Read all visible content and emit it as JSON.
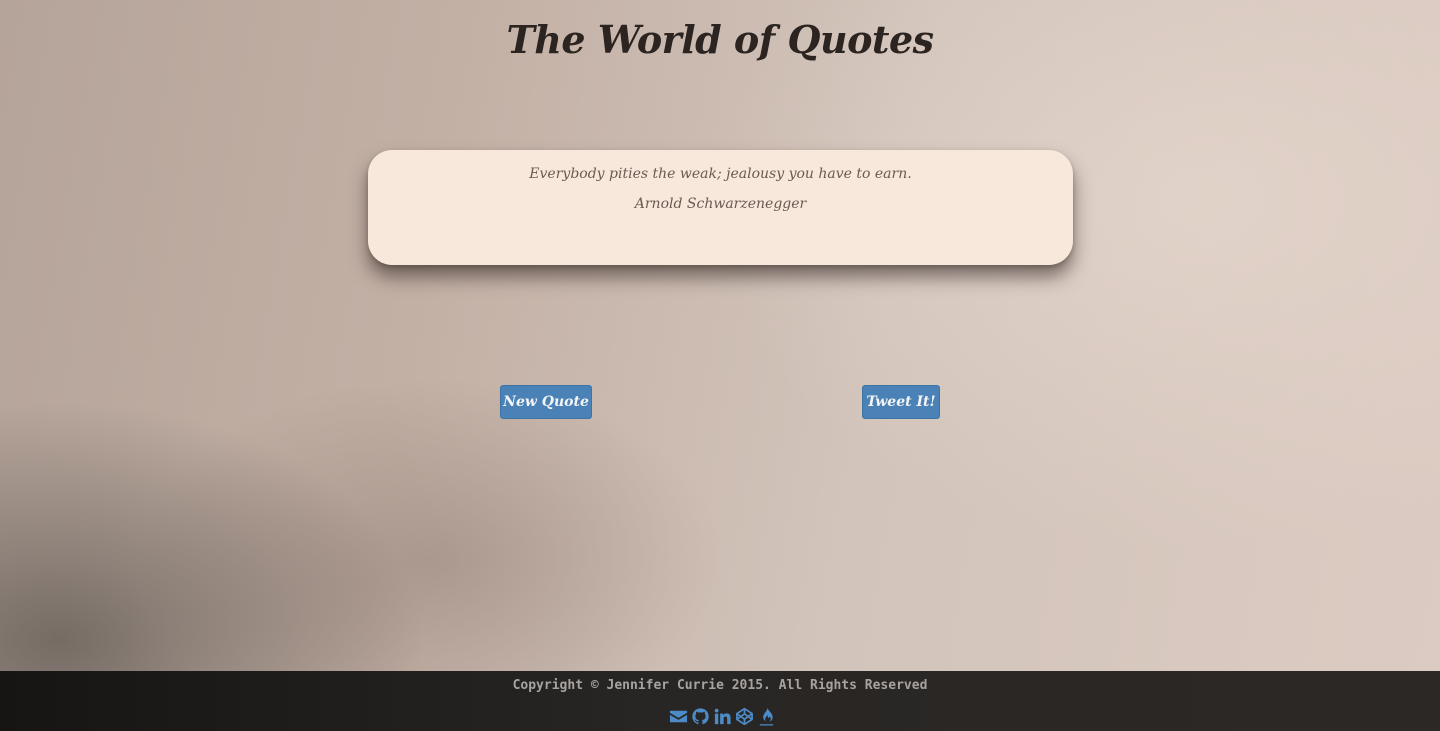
{
  "header": {
    "title": "The World of Quotes"
  },
  "quote": {
    "text": "Everybody pities the weak; jealousy you have to earn.",
    "author": "Arnold Schwarzenegger"
  },
  "actions": {
    "new_quote_label": "New Quote",
    "tweet_label": "Tweet It!"
  },
  "footer": {
    "copyright": "Copyright © Jennifer Currie 2015. All Rights Reserved",
    "social_icons": [
      "envelope-icon",
      "github-icon",
      "linkedin-icon",
      "codepen-icon",
      "freecodecamp-icon"
    ]
  },
  "colors": {
    "button": "#4a82b8",
    "icon": "#4c8bc6",
    "card": "#f7e8db",
    "footer": "#211f1d"
  }
}
